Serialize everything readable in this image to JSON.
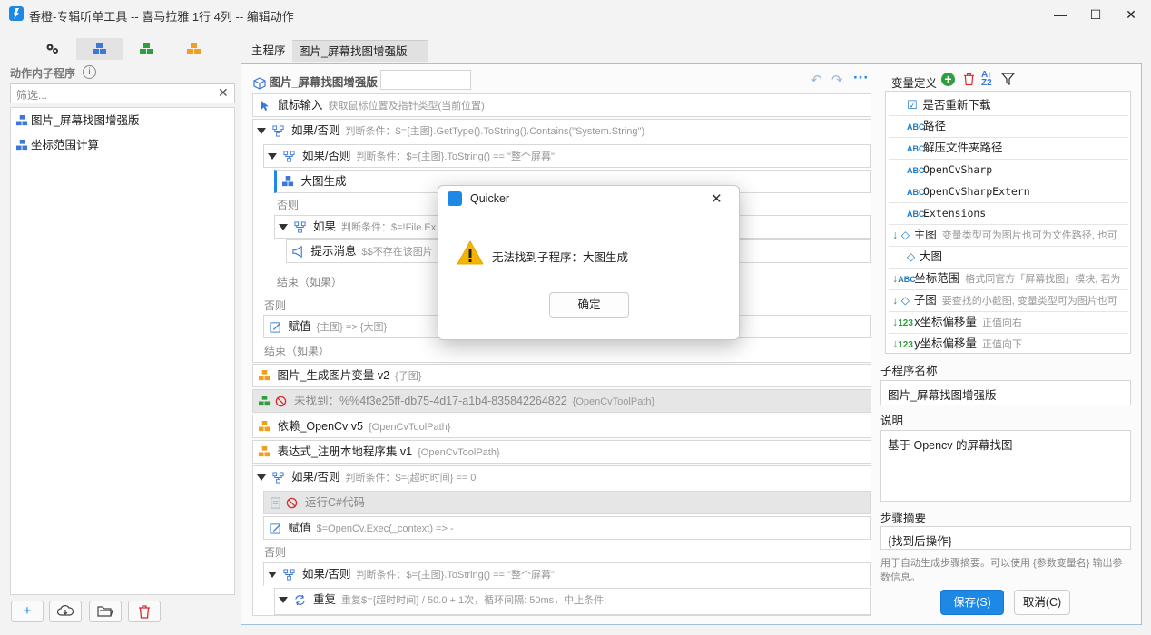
{
  "window": {
    "title": "香橙-专辑听单工具 -- 喜马拉雅 1行 4列 -- 编辑动作",
    "minimize": "—",
    "maximize": "☐",
    "close": "✕"
  },
  "left": {
    "section_label": "动作内子程序",
    "filter_placeholder": "筛选...",
    "subprograms": [
      "图片_屏幕找图增强版",
      "坐标范围计算"
    ]
  },
  "tabs": [
    {
      "label": "主程序",
      "close": ""
    },
    {
      "label": "图片_屏幕找图增强版",
      "close": "x"
    }
  ],
  "editor": {
    "title": "图片_屏幕找图增强版",
    "steps": {
      "s1": {
        "label": "鼠标输入",
        "hint": "获取鼠标位置及指针类型(当前位置)"
      },
      "s2": {
        "label": "如果/否则",
        "hint": "判断条件：$={主图}.GetType().ToString().Contains(\"System.String\")"
      },
      "s3": {
        "label": "如果/否则",
        "hint": "判断条件：$={主图}.ToString() == \"整个屏幕\""
      },
      "s4": {
        "label": "大图生成"
      },
      "else1": "否则",
      "s5": {
        "label": "如果",
        "hint": "判断条件：$=!File.Ex"
      },
      "s6": {
        "label": "提示消息",
        "hint": "$$不存在该图片"
      },
      "end1": "结束（如果）",
      "else2": "否则",
      "s7": {
        "label": "赋值",
        "hint": "{主图} => {大图}"
      },
      "end2": "结束（如果）",
      "s8": {
        "label": "图片_生成图片变量 v2",
        "hint": "{子图}"
      },
      "s9": {
        "label": "未找到：%%4f3e25ff-db75-4d17-a1b4-835842264822",
        "hint": "{OpenCvToolPath}"
      },
      "s10": {
        "label": "依赖_OpenCv v5",
        "hint": "{OpenCvToolPath}"
      },
      "s11": {
        "label": "表达式_注册本地程序集 v1",
        "hint": "{OpenCvToolPath}"
      },
      "s12": {
        "label": "如果/否则",
        "hint": "判断条件：$={超时时间} == 0"
      },
      "s13": {
        "label": "运行C#代码"
      },
      "s14": {
        "label": "赋值",
        "hint": "$=OpenCv.Exec(_context) => -"
      },
      "else3": "否则",
      "s15": {
        "label": "如果/否则",
        "hint": "判断条件：$={主图}.ToString() == \"整个屏幕\""
      },
      "s16": {
        "label": "重复",
        "hint": "重复$={超时时间} / 50.0 + 1次，循环间隔: 50ms，中止条件:"
      }
    }
  },
  "vars": {
    "header": "变量定义",
    "items": [
      {
        "name": "是否重新下载",
        "desc": ""
      },
      {
        "name": "路径",
        "desc": ""
      },
      {
        "name": "解压文件夹路径",
        "desc": ""
      },
      {
        "name": "OpenCvSharp",
        "desc": ""
      },
      {
        "name": "OpenCvSharpExtern",
        "desc": ""
      },
      {
        "name": "Extensions",
        "desc": ""
      },
      {
        "name": "主图",
        "desc": "变量类型可为图片也可为文件路径, 也可"
      },
      {
        "name": "大图",
        "desc": ""
      },
      {
        "name": "坐标范围",
        "desc": "格式同官方「屏幕找图」模块, 若为"
      },
      {
        "name": "子图",
        "desc": "要查找的小截图, 变量类型可为图片也可"
      },
      {
        "name": "x坐标偏移量",
        "desc": "正值向右"
      },
      {
        "name": "y坐标偏移量",
        "desc": "正值向下"
      }
    ],
    "tags": {
      "bool": "☑",
      "text": "ABC",
      "obj": "◇",
      "num": "123"
    }
  },
  "props": {
    "name_label": "子程序名称",
    "name_value": "图片_屏幕找图增强版",
    "desc_label": "说明",
    "desc_value": "基于 Opencv 的屏幕找图",
    "summary_label": "步骤摘要",
    "summary_value": "{找到后操作}",
    "summary_help": "用于自动生成步骤摘要。可以使用 {参数变量名} 输出参数信息。",
    "save": "保存(S)",
    "cancel": "取消(C)"
  },
  "dialog": {
    "title": "Quicker",
    "message": "无法找到子程序：大图生成",
    "ok": "确定"
  },
  "colors": {
    "accent": "#1e88e5",
    "warning": "#f4b400",
    "blue_icon": "#3c78d8",
    "orange_icon": "#f0a020",
    "green_icon": "#2e9e3e",
    "red": "#d32f2f"
  }
}
